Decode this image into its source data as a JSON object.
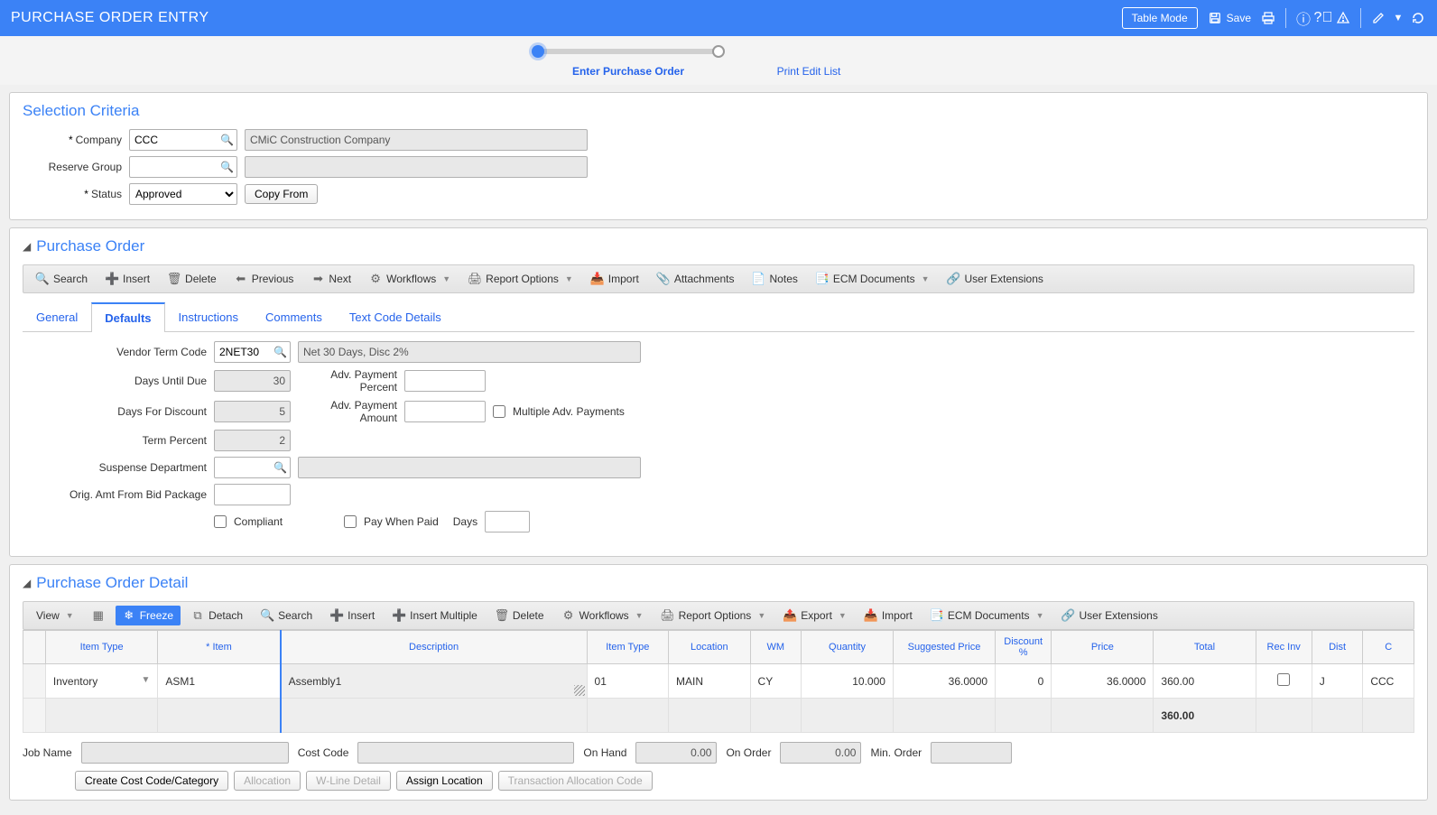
{
  "header": {
    "title": "PURCHASE ORDER ENTRY",
    "table_mode": "Table Mode",
    "save": "Save"
  },
  "wizard": {
    "step1": "Enter Purchase Order",
    "step2": "Print Edit List"
  },
  "selection": {
    "title": "Selection Criteria",
    "labels": {
      "company": "Company",
      "reserve_group": "Reserve Group",
      "status": "Status"
    },
    "company_code": "CCC",
    "company_name": "CMiC Construction Company",
    "reserve_group": "",
    "reserve_group_name": "",
    "status_options": [
      "Approved"
    ],
    "status_value": "Approved",
    "copy_from": "Copy From"
  },
  "po": {
    "title": "Purchase Order",
    "toolbar": {
      "search": "Search",
      "insert": "Insert",
      "delete": "Delete",
      "previous": "Previous",
      "next": "Next",
      "workflows": "Workflows",
      "report_options": "Report Options",
      "import": "Import",
      "attachments": "Attachments",
      "notes": "Notes",
      "ecm_documents": "ECM Documents",
      "user_extensions": "User Extensions"
    },
    "tabs": {
      "general": "General",
      "defaults": "Defaults",
      "instructions": "Instructions",
      "comments": "Comments",
      "text_code_details": "Text Code Details"
    },
    "defaults": {
      "labels": {
        "vendor_term_code": "Vendor Term Code",
        "days_until_due": "Days Until Due",
        "days_for_discount": "Days For Discount",
        "term_percent": "Term Percent",
        "suspense_department": "Suspense Department",
        "orig_amt": "Orig. Amt From Bid Package",
        "adv_payment_percent": "Adv. Payment Percent",
        "adv_payment_amount": "Adv. Payment Amount",
        "multiple_adv": "Multiple Adv. Payments",
        "compliant": "Compliant",
        "pay_when_paid": "Pay When Paid",
        "days": "Days"
      },
      "vendor_term_code": "2NET30",
      "vendor_term_desc": "Net 30 Days, Disc 2%",
      "days_until_due": "30",
      "days_for_discount": "5",
      "term_percent": "2",
      "suspense_department": "",
      "suspense_department_desc": "",
      "orig_amt": "",
      "adv_payment_percent": "",
      "adv_payment_amount": "",
      "multiple_adv": false,
      "compliant": false,
      "pay_when_paid": false,
      "pay_when_paid_days": ""
    }
  },
  "detail": {
    "title": "Purchase Order Detail",
    "toolbar": {
      "view": "View",
      "freeze": "Freeze",
      "detach": "Detach",
      "search": "Search",
      "insert": "Insert",
      "insert_multiple": "Insert Multiple",
      "delete": "Delete",
      "workflows": "Workflows",
      "report_options": "Report Options",
      "export": "Export",
      "import": "Import",
      "ecm_documents": "ECM Documents",
      "user_extensions": "User Extensions"
    },
    "columns": {
      "item_type": "Item Type",
      "item": "* Item",
      "description": "Description",
      "item_type2": "Item Type",
      "location": "Location",
      "wm": "WM",
      "quantity": "Quantity",
      "suggested_price": "Suggested Price",
      "discount_pct": "Discount %",
      "price": "Price",
      "total": "Total",
      "rec_inv": "Rec Inv",
      "dist": "Dist",
      "c": "C"
    },
    "rows": [
      {
        "item_type": "Inventory",
        "item": "ASM1",
        "description": "Assembly1",
        "item_type2": "01",
        "location": "MAIN",
        "wm": "CY",
        "quantity": "10.000",
        "suggested_price": "36.0000",
        "discount_pct": "0",
        "price": "36.0000",
        "total": "360.00",
        "rec_inv": false,
        "dist": "J",
        "c": "CCC"
      }
    ],
    "totals": {
      "total": "360.00"
    },
    "footer": {
      "labels": {
        "job_name": "Job Name",
        "cost_code": "Cost Code",
        "on_hand": "On Hand",
        "on_order": "On Order",
        "min_order": "Min. Order"
      },
      "job_name": "",
      "cost_code": "",
      "on_hand": "0.00",
      "on_order": "0.00",
      "min_order": ""
    },
    "buttons": {
      "create_cost_code": "Create Cost Code/Category",
      "allocation": "Allocation",
      "wline_detail": "W-Line Detail",
      "assign_location": "Assign Location",
      "transaction_allocation_code": "Transaction Allocation Code"
    }
  }
}
